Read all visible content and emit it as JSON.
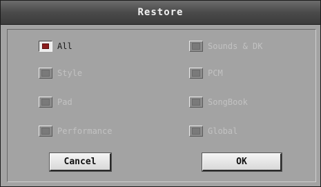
{
  "dialog": {
    "title": "Restore"
  },
  "options": {
    "all": {
      "label": "All",
      "checked": true,
      "enabled": true
    },
    "style": {
      "label": "Style",
      "checked": false,
      "enabled": false
    },
    "pad": {
      "label": "Pad",
      "checked": false,
      "enabled": false
    },
    "performance": {
      "label": "Performance",
      "checked": false,
      "enabled": false
    },
    "sounds_dk": {
      "label": "Sounds & DK",
      "checked": false,
      "enabled": false
    },
    "pcm": {
      "label": "PCM",
      "checked": false,
      "enabled": false
    },
    "songbook": {
      "label": "SongBook",
      "checked": false,
      "enabled": false
    },
    "global": {
      "label": "Global",
      "checked": false,
      "enabled": false
    }
  },
  "buttons": {
    "cancel": "Cancel",
    "ok": "OK"
  },
  "colors": {
    "panel": "#a3a3a3",
    "checked_mark": "#8b1e1e",
    "disabled_text": "#c2c2c2",
    "title_bar": "#4a4a4a"
  }
}
